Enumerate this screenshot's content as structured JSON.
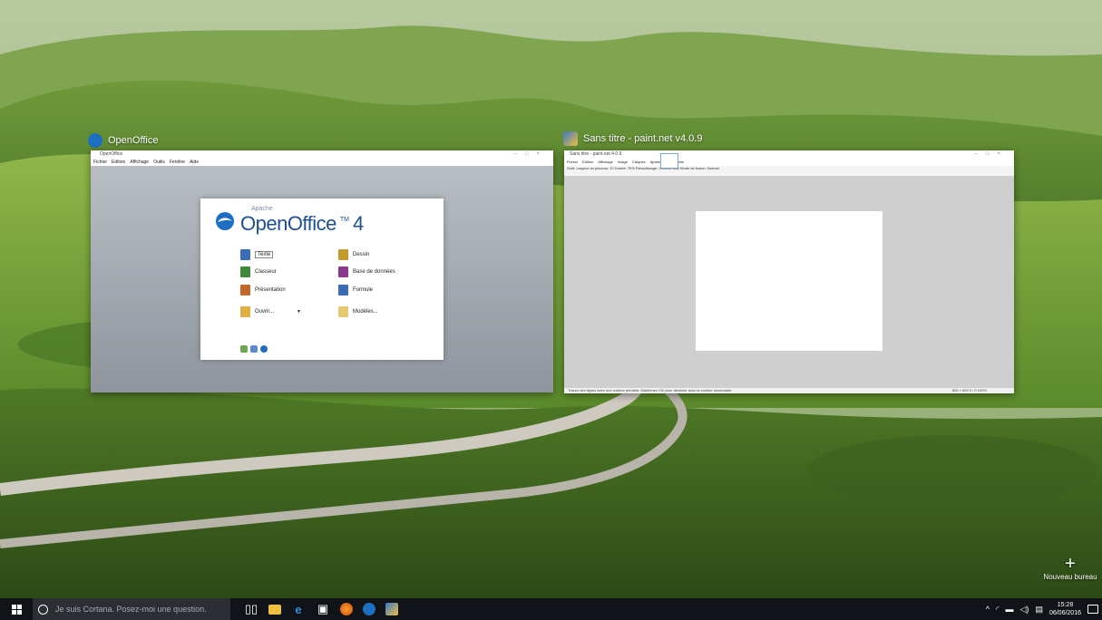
{
  "desktop": {
    "new_desktop_label": "Nouveau bureau",
    "new_desktop_symbol": "+"
  },
  "openoffice": {
    "task_label": "OpenOffice",
    "window_title": "OpenOffice",
    "menu": [
      "Fichier",
      "Edition",
      "Affichage",
      "Outils",
      "Fenêtre",
      "Aide"
    ],
    "logo": {
      "vendor": "Apache",
      "name": "OpenOffice",
      "tm": "TM",
      "version": "4"
    },
    "start_items": [
      {
        "label": "Texte",
        "icon": "writer-icon",
        "color": "#3a6db5"
      },
      {
        "label": "Dessin",
        "icon": "draw-icon",
        "color": "#c29b2a"
      },
      {
        "label": "Classeur",
        "icon": "calc-icon",
        "color": "#3e8a3a"
      },
      {
        "label": "Base de données",
        "icon": "base-icon",
        "color": "#8a3a8a"
      },
      {
        "label": "Présentation",
        "icon": "impress-icon",
        "color": "#c4672a"
      },
      {
        "label": "Formule",
        "icon": "math-icon",
        "color": "#3a6db5"
      },
      {
        "label": "Ouvrir...",
        "icon": "open-folder-icon",
        "color": "#e0b040"
      },
      {
        "label": "Modèles...",
        "icon": "templates-icon",
        "color": "#e6c870"
      }
    ],
    "accent_color": "#1d4f91"
  },
  "paintnet": {
    "task_label": "Sans titre - paint.net v4.0.9",
    "window_title": "Sans titre - paint.net 4.0.9",
    "menu": [
      "Fichier",
      "Edition",
      "Affichage",
      "Image",
      "Calques",
      "Ajustements",
      "Effets"
    ],
    "toolbar_text": "Outil: Largeur du pinceau: 10 Dureté: 75% Remplissage: Couleur unie Mode de fusion: Normal",
    "status_text": "Tracez des lignes avec une couleur primaire. Maintenez Ctrl pour dessiner avec la couleur secondaire.",
    "status_right": "800 × 600    0 / 0   100%"
  },
  "taskbar": {
    "cortana_placeholder": "Je suis Cortana. Posez-moi une question.",
    "pinned": [
      "task-view-icon",
      "file-explorer-icon",
      "edge-icon",
      "store-icon",
      "firefox-icon",
      "openoffice-icon",
      "paintnet-icon"
    ],
    "time": "15:28",
    "date": "06/06/2016",
    "tray_chevron": "^"
  }
}
